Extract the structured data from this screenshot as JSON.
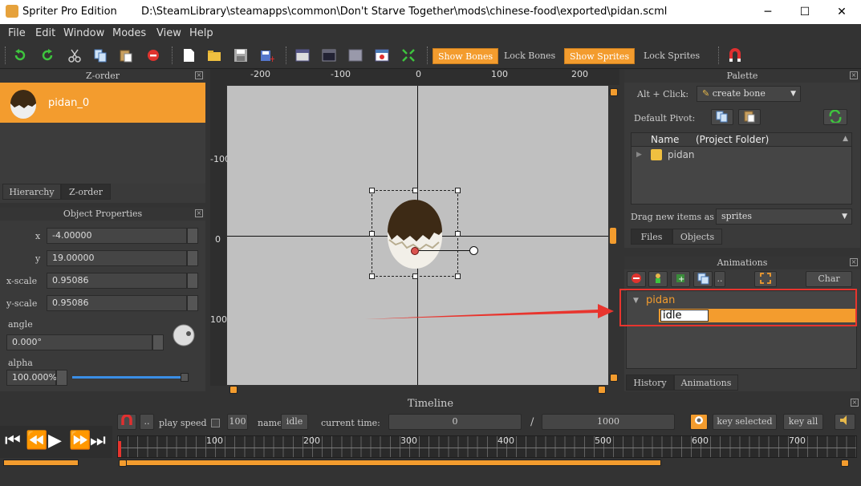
{
  "window": {
    "app_title": "Spriter Pro Edition",
    "file_path": "D:\\SteamLibrary\\steamapps\\common\\Don't Starve Together\\mods\\chinese-food\\exported\\pidan.scml",
    "minimize": "─",
    "maximize": "☐",
    "close": "✕"
  },
  "menu": [
    "File",
    "Edit",
    "Window",
    "Modes",
    "View",
    "Help"
  ],
  "toolbar": {
    "show_bones": "Show Bones",
    "lock_bones": "Lock Bones",
    "show_sprites": "Show Sprites",
    "lock_sprites": "Lock Sprites"
  },
  "zorder": {
    "title": "Z-order",
    "item": "pidan_0",
    "tabs": [
      "Hierarchy",
      "Z-order"
    ]
  },
  "object_properties": {
    "title": "Object Properties",
    "x_label": "x",
    "x_value": "-4.00000",
    "y_label": "y",
    "y_value": "19.00000",
    "xscale_label": "x-scale",
    "xscale_value": "0.95086",
    "yscale_label": "y-scale",
    "yscale_value": "0.95086",
    "angle_label": "angle",
    "angle_value": "0.000°",
    "alpha_label": "alpha",
    "alpha_value": "100.000%",
    "alpha_fraction": 1.0
  },
  "canvas": {
    "ruler_top": [
      "-200",
      "-100",
      "0",
      "100",
      "200"
    ],
    "ruler_left": [
      "-100",
      "0",
      "100"
    ]
  },
  "palette": {
    "title": "Palette",
    "alt_click_label": "Alt + Click:",
    "alt_click_value": "create bone",
    "default_pivot_label": "Default Pivot:",
    "col_name": "Name",
    "col_folder": "(Project Folder)",
    "folder": "pidan",
    "drag_label": "Drag new items as",
    "drag_value": "sprites",
    "tabs": [
      "Files",
      "Objects"
    ]
  },
  "animations": {
    "title": "Animations",
    "char_maps": "Char Maps",
    "entity": "pidan",
    "animation": "idle",
    "tabs": [
      "History",
      "Animations"
    ]
  },
  "timeline": {
    "title": "Timeline",
    "play_speed_label": "play speed",
    "play_speed_value": "100",
    "name_label": "name",
    "name_value": "idle",
    "current_time_label": "current time:",
    "current_time_value": "0",
    "slash": "/",
    "total_time": "1000",
    "key_selected": "key selected",
    "key_all": "key all",
    "ticks": [
      "100",
      "200",
      "300",
      "400",
      "500",
      "600",
      "700"
    ]
  },
  "colors": {
    "accent": "#f39c2e",
    "annotation_red": "#e8352e"
  }
}
